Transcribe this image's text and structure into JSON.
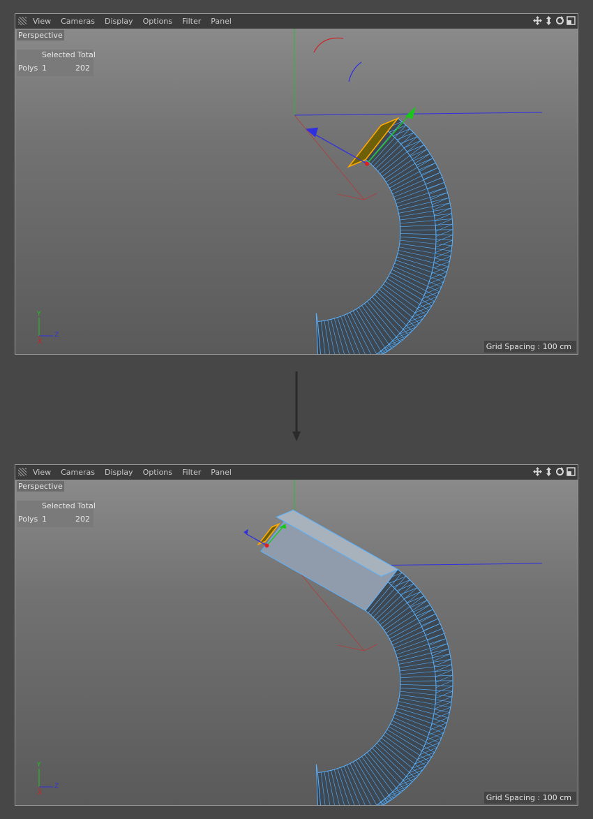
{
  "viewports": [
    {
      "menu": [
        "View",
        "Cameras",
        "Display",
        "Options",
        "Filter",
        "Panel"
      ],
      "camera": "Perspective",
      "hud": {
        "header": "Selected Total",
        "row_label": "Polys",
        "selected": "1",
        "total": "202"
      },
      "grid_spacing": "Grid Spacing : 100 cm",
      "axis": {
        "y": "Y",
        "z": "Z",
        "x": "X"
      },
      "extruded": false
    },
    {
      "menu": [
        "View",
        "Cameras",
        "Display",
        "Options",
        "Filter",
        "Panel"
      ],
      "camera": "Perspective",
      "hud": {
        "header": "Selected Total",
        "row_label": "Polys",
        "selected": "1",
        "total": "202"
      },
      "grid_spacing": "Grid Spacing : 100 cm",
      "axis": {
        "y": "Y",
        "z": "Z",
        "x": "X"
      },
      "extruded": true
    }
  ],
  "icons": [
    "move-view-icon",
    "zoom-view-icon",
    "rotate-view-icon",
    "toggle-layout-icon"
  ],
  "colors": {
    "wire": "#5ab2ff",
    "selected_face": "#6d6008",
    "selected_edge": "#ffa800",
    "axis_x": "#d02020",
    "axis_y": "#18c818",
    "axis_z": "#3030e0"
  }
}
